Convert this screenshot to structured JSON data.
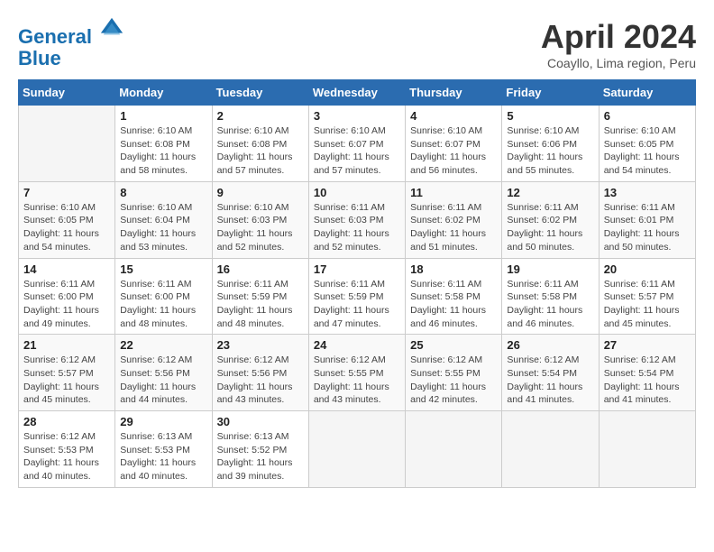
{
  "header": {
    "logo_line1": "General",
    "logo_line2": "Blue",
    "month": "April 2024",
    "location": "Coayllo, Lima region, Peru"
  },
  "days_of_week": [
    "Sunday",
    "Monday",
    "Tuesday",
    "Wednesday",
    "Thursday",
    "Friday",
    "Saturday"
  ],
  "weeks": [
    [
      null,
      {
        "day": 1,
        "sunrise": "Sunrise: 6:10 AM",
        "sunset": "Sunset: 6:08 PM",
        "daylight": "Daylight: 11 hours and 58 minutes."
      },
      {
        "day": 2,
        "sunrise": "Sunrise: 6:10 AM",
        "sunset": "Sunset: 6:08 PM",
        "daylight": "Daylight: 11 hours and 57 minutes."
      },
      {
        "day": 3,
        "sunrise": "Sunrise: 6:10 AM",
        "sunset": "Sunset: 6:07 PM",
        "daylight": "Daylight: 11 hours and 57 minutes."
      },
      {
        "day": 4,
        "sunrise": "Sunrise: 6:10 AM",
        "sunset": "Sunset: 6:07 PM",
        "daylight": "Daylight: 11 hours and 56 minutes."
      },
      {
        "day": 5,
        "sunrise": "Sunrise: 6:10 AM",
        "sunset": "Sunset: 6:06 PM",
        "daylight": "Daylight: 11 hours and 55 minutes."
      },
      {
        "day": 6,
        "sunrise": "Sunrise: 6:10 AM",
        "sunset": "Sunset: 6:05 PM",
        "daylight": "Daylight: 11 hours and 54 minutes."
      }
    ],
    [
      {
        "day": 7,
        "sunrise": "Sunrise: 6:10 AM",
        "sunset": "Sunset: 6:05 PM",
        "daylight": "Daylight: 11 hours and 54 minutes."
      },
      {
        "day": 8,
        "sunrise": "Sunrise: 6:10 AM",
        "sunset": "Sunset: 6:04 PM",
        "daylight": "Daylight: 11 hours and 53 minutes."
      },
      {
        "day": 9,
        "sunrise": "Sunrise: 6:10 AM",
        "sunset": "Sunset: 6:03 PM",
        "daylight": "Daylight: 11 hours and 52 minutes."
      },
      {
        "day": 10,
        "sunrise": "Sunrise: 6:11 AM",
        "sunset": "Sunset: 6:03 PM",
        "daylight": "Daylight: 11 hours and 52 minutes."
      },
      {
        "day": 11,
        "sunrise": "Sunrise: 6:11 AM",
        "sunset": "Sunset: 6:02 PM",
        "daylight": "Daylight: 11 hours and 51 minutes."
      },
      {
        "day": 12,
        "sunrise": "Sunrise: 6:11 AM",
        "sunset": "Sunset: 6:02 PM",
        "daylight": "Daylight: 11 hours and 50 minutes."
      },
      {
        "day": 13,
        "sunrise": "Sunrise: 6:11 AM",
        "sunset": "Sunset: 6:01 PM",
        "daylight": "Daylight: 11 hours and 50 minutes."
      }
    ],
    [
      {
        "day": 14,
        "sunrise": "Sunrise: 6:11 AM",
        "sunset": "Sunset: 6:00 PM",
        "daylight": "Daylight: 11 hours and 49 minutes."
      },
      {
        "day": 15,
        "sunrise": "Sunrise: 6:11 AM",
        "sunset": "Sunset: 6:00 PM",
        "daylight": "Daylight: 11 hours and 48 minutes."
      },
      {
        "day": 16,
        "sunrise": "Sunrise: 6:11 AM",
        "sunset": "Sunset: 5:59 PM",
        "daylight": "Daylight: 11 hours and 48 minutes."
      },
      {
        "day": 17,
        "sunrise": "Sunrise: 6:11 AM",
        "sunset": "Sunset: 5:59 PM",
        "daylight": "Daylight: 11 hours and 47 minutes."
      },
      {
        "day": 18,
        "sunrise": "Sunrise: 6:11 AM",
        "sunset": "Sunset: 5:58 PM",
        "daylight": "Daylight: 11 hours and 46 minutes."
      },
      {
        "day": 19,
        "sunrise": "Sunrise: 6:11 AM",
        "sunset": "Sunset: 5:58 PM",
        "daylight": "Daylight: 11 hours and 46 minutes."
      },
      {
        "day": 20,
        "sunrise": "Sunrise: 6:11 AM",
        "sunset": "Sunset: 5:57 PM",
        "daylight": "Daylight: 11 hours and 45 minutes."
      }
    ],
    [
      {
        "day": 21,
        "sunrise": "Sunrise: 6:12 AM",
        "sunset": "Sunset: 5:57 PM",
        "daylight": "Daylight: 11 hours and 45 minutes."
      },
      {
        "day": 22,
        "sunrise": "Sunrise: 6:12 AM",
        "sunset": "Sunset: 5:56 PM",
        "daylight": "Daylight: 11 hours and 44 minutes."
      },
      {
        "day": 23,
        "sunrise": "Sunrise: 6:12 AM",
        "sunset": "Sunset: 5:56 PM",
        "daylight": "Daylight: 11 hours and 43 minutes."
      },
      {
        "day": 24,
        "sunrise": "Sunrise: 6:12 AM",
        "sunset": "Sunset: 5:55 PM",
        "daylight": "Daylight: 11 hours and 43 minutes."
      },
      {
        "day": 25,
        "sunrise": "Sunrise: 6:12 AM",
        "sunset": "Sunset: 5:55 PM",
        "daylight": "Daylight: 11 hours and 42 minutes."
      },
      {
        "day": 26,
        "sunrise": "Sunrise: 6:12 AM",
        "sunset": "Sunset: 5:54 PM",
        "daylight": "Daylight: 11 hours and 41 minutes."
      },
      {
        "day": 27,
        "sunrise": "Sunrise: 6:12 AM",
        "sunset": "Sunset: 5:54 PM",
        "daylight": "Daylight: 11 hours and 41 minutes."
      }
    ],
    [
      {
        "day": 28,
        "sunrise": "Sunrise: 6:12 AM",
        "sunset": "Sunset: 5:53 PM",
        "daylight": "Daylight: 11 hours and 40 minutes."
      },
      {
        "day": 29,
        "sunrise": "Sunrise: 6:13 AM",
        "sunset": "Sunset: 5:53 PM",
        "daylight": "Daylight: 11 hours and 40 minutes."
      },
      {
        "day": 30,
        "sunrise": "Sunrise: 6:13 AM",
        "sunset": "Sunset: 5:52 PM",
        "daylight": "Daylight: 11 hours and 39 minutes."
      },
      null,
      null,
      null,
      null
    ]
  ]
}
